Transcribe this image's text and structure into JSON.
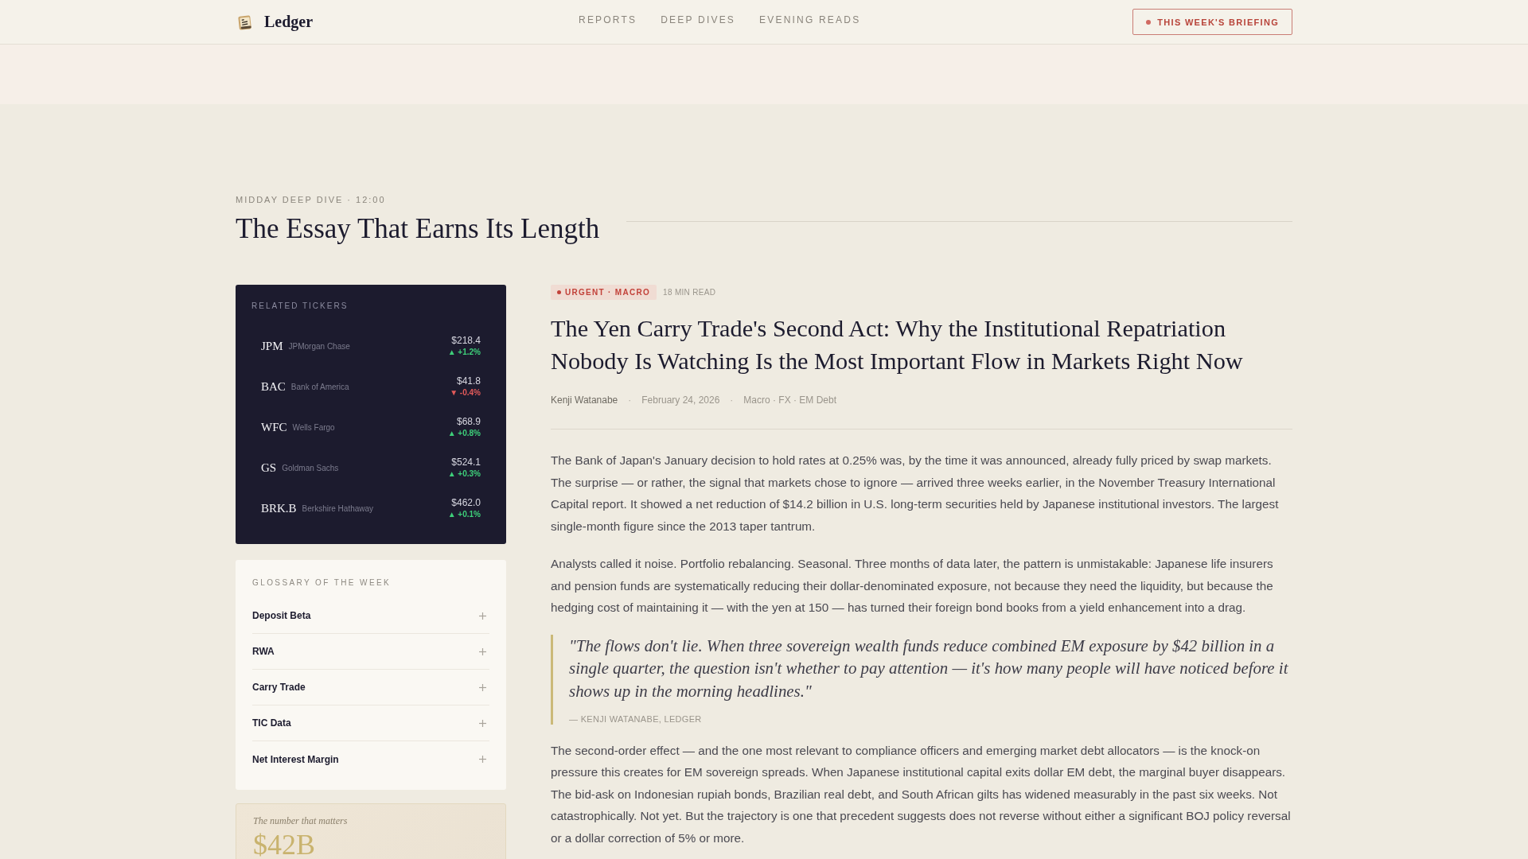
{
  "header": {
    "logo": {
      "name": "Ledger"
    },
    "nav": [
      {
        "label": "REPORTS",
        "selected": false
      },
      {
        "label": "DEEP DIVES",
        "selected": false
      },
      {
        "label": "EVENING READS",
        "selected": false
      }
    ],
    "cta": {
      "label": "THIS WEEK'S BRIEFING"
    }
  },
  "section": {
    "eyebrow": "MIDDAY DEEP DIVE · 12:00",
    "title": "The Essay That Earns Its Length"
  },
  "tickers": {
    "title": "RELATED TICKERS",
    "items": [
      {
        "symbol": "JPM",
        "name": "JPMorgan Chase",
        "price": "$218.4",
        "change": "▲ +1.2%",
        "positive": true
      },
      {
        "symbol": "BAC",
        "name": "Bank of America",
        "price": "$41.8",
        "change": "▼ -0.4%",
        "positive": false
      },
      {
        "symbol": "WFC",
        "name": "Wells Fargo",
        "price": "$68.9",
        "change": "▲ +0.8%",
        "positive": true
      },
      {
        "symbol": "GS",
        "name": "Goldman Sachs",
        "price": "$524.1",
        "change": "▲ +0.3%",
        "positive": true
      },
      {
        "symbol": "BRK.B",
        "name": "Berkshire Hathaway",
        "price": "$462.0",
        "change": "▲ +0.1%",
        "positive": true
      }
    ]
  },
  "glossary": {
    "title": "GLOSSARY OF THE WEEK",
    "items": [
      {
        "term": "Deposit Beta",
        "expanded": false
      },
      {
        "term": "RWA",
        "expanded": false
      },
      {
        "term": "Carry Trade",
        "expanded": false
      },
      {
        "term": "TIC Data",
        "expanded": false
      },
      {
        "term": "Net Interest Margin",
        "expanded": false
      }
    ]
  },
  "stat_card": {
    "label": "The number that matters",
    "value": "$42B"
  },
  "article": {
    "badge": "URGENT · MACRO",
    "read_time": "18 MIN READ",
    "title": "The Yen Carry Trade's Second Act: Why the Institutional Repatriation Nobody Is Watching Is the Most Important Flow in Markets Right Now",
    "byline": [
      {
        "kind": "author",
        "text": "Kenji Watanabe"
      },
      {
        "kind": "separator",
        "text": "·"
      },
      {
        "kind": "date",
        "text": "February 24, 2026"
      },
      {
        "kind": "separator",
        "text": "·"
      },
      {
        "kind": "topics",
        "text": "Macro · FX · EM Debt"
      }
    ],
    "body": [
      {
        "kind": "paragraph",
        "text": "The Bank of Japan's January decision to hold rates at 0.25% was, by the time it was announced, already fully priced by swap markets. The surprise — or rather, the signal that markets chose to ignore — arrived three weeks earlier, in the November Treasury International Capital report. It showed a net reduction of $14.2 billion in U.S. long-term securities held by Japanese institutional investors. The largest single-month figure since the 2013 taper tantrum."
      },
      {
        "kind": "paragraph",
        "text": "Analysts called it noise. Portfolio rebalancing. Seasonal. Three months of data later, the pattern is unmistakable: Japanese life insurers and pension funds are systematically reducing their dollar-denominated exposure, not because they need the liquidity, but because the hedging cost of maintaining it — with the yen at 150 — has turned their foreign bond books from a yield enhancement into a drag."
      },
      {
        "kind": "quote",
        "text": "\"The flows don't lie. When three sovereign wealth funds reduce combined EM exposure by $42 billion in a single quarter, the question isn't whether to pay attention — it's how many people will have noticed before it shows up in the morning headlines.\"",
        "attribution": "— KENJI WATANABE, LEDGER"
      },
      {
        "kind": "paragraph",
        "text": "The second-order effect — and the one most relevant to compliance officers and emerging market debt allocators — is the knock-on pressure this creates for EM sovereign spreads. When Japanese institutional capital exits dollar EM debt, the marginal buyer disappears. The bid-ask on Indonesian rupiah bonds, Brazilian real debt, and South African gilts has widened measurably in the past six weeks. Not catastrophically. Not yet. But the trajectory is one that precedent suggests does not reverse without either a significant BOJ policy reversal or a dollar correction of 5% or more."
      }
    ]
  }
}
